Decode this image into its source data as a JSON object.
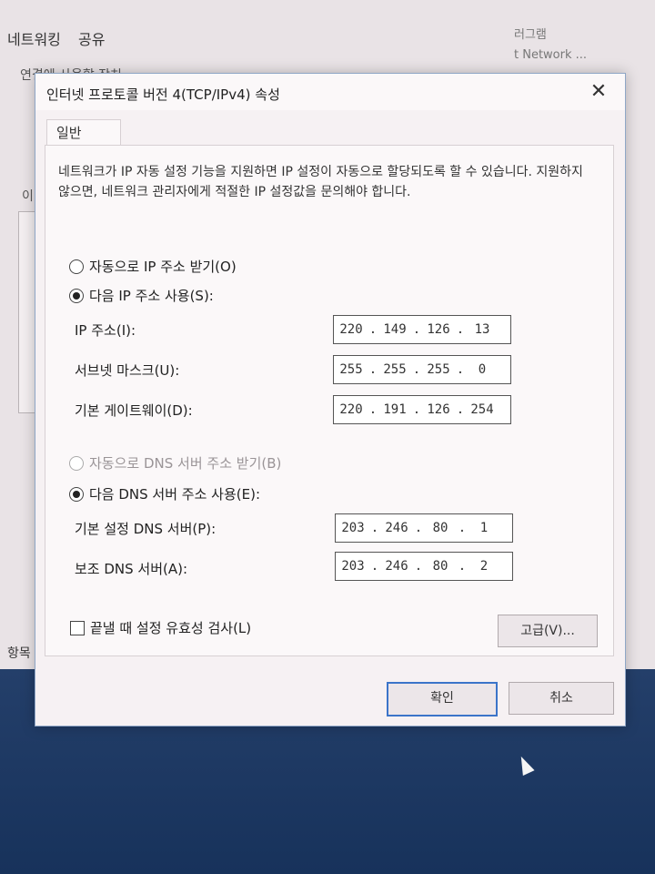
{
  "background_window": {
    "tabs": [
      "네트워킹",
      "공유"
    ],
    "fragment_top": "연결에 사용할 장치",
    "fragment_mid": "이",
    "fragment_bottom": "항목",
    "right_line1": "러그램",
    "right_line2": "t Network ..."
  },
  "dialog": {
    "title": "인터넷 프로토콜 버전 4(TCP/IPv4) 속성",
    "close_label": "✕",
    "tab_general": "일반",
    "description": "네트워크가 IP 자동 설정 기능을 지원하면 IP 설정이 자동으로 할당되도록 할 수 있습니다. 지원하지 않으면, 네트워크 관리자에게 적절한 IP 설정값을 문의해야 합니다.",
    "radio_auto_ip": "자동으로 IP 주소 받기(O)",
    "radio_manual_ip": "다음 IP 주소 사용(S):",
    "ip_label": "IP 주소(I):",
    "ip_value": [
      "220",
      "149",
      "126",
      "13"
    ],
    "subnet_label": "서브넷 마스크(U):",
    "subnet_value": [
      "255",
      "255",
      "255",
      "0"
    ],
    "gateway_label": "기본 게이트웨이(D):",
    "gateway_value": [
      "220",
      "191",
      "126",
      "254"
    ],
    "radio_auto_dns": "자동으로 DNS 서버 주소 받기(B)",
    "radio_manual_dns": "다음 DNS 서버 주소 사용(E):",
    "dns_pref_label": "기본 설정 DNS 서버(P):",
    "dns_pref_value": [
      "203",
      "246",
      "80",
      "1"
    ],
    "dns_alt_label": "보조 DNS 서버(A):",
    "dns_alt_value": [
      "203",
      "246",
      "80",
      "2"
    ],
    "validate_label": "끝낼 때 설정 유효성 검사(L)",
    "advanced_button": "고급(V)...",
    "ok_button": "확인",
    "cancel_button": "취소"
  },
  "state": {
    "ip_mode": "manual",
    "dns_mode": "manual",
    "validate_checked": false
  }
}
